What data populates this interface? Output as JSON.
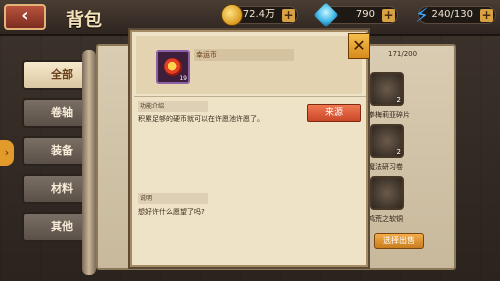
{
  "header": {
    "title": "背包",
    "back_icon": "back-arrow-icon"
  },
  "resources": {
    "gold": "72.4万",
    "diamond": "790",
    "energy": "240/130"
  },
  "tabs": [
    {
      "label": "全部",
      "active": true
    },
    {
      "label": "卷轴",
      "active": false
    },
    {
      "label": "装备",
      "active": false
    },
    {
      "label": "材料",
      "active": false
    },
    {
      "label": "其他",
      "active": false
    }
  ],
  "inventory": {
    "count": "171/200",
    "items": [
      {
        "label": "拳梅莉亚碎片",
        "count": "2"
      },
      {
        "label": "魔法研习卷",
        "count": "2"
      },
      {
        "label": "鸿荒之软铜",
        "count": ""
      }
    ],
    "sell_label": "选择出售"
  },
  "popup": {
    "item_name": "幸运币",
    "item_count": "19",
    "desc_label": "功能介绍",
    "desc_text": "积累足够的硬币就可以在许愿池许愿了。",
    "source_label": "来源",
    "note_label": "说明",
    "note_text": "想好许什么愿望了吗?",
    "close_symbol": "✕"
  }
}
